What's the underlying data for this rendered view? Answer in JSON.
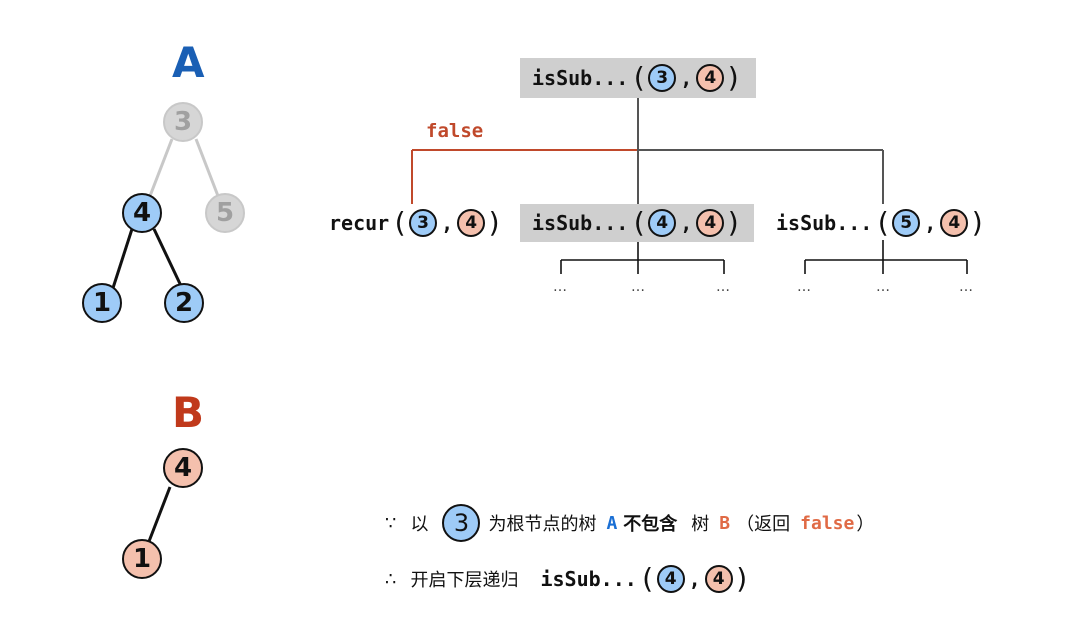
{
  "colors": {
    "blue_fill": "#9ecbf7",
    "pink_fill": "#f4c0ad",
    "gray_fill": "#d6d6d6",
    "label_a": "#1a5fb4",
    "label_b": "#c0391b",
    "false_path": "#c0492b",
    "highlight": "#cfcfcf"
  },
  "tree_a": {
    "label": "A",
    "nodes": [
      {
        "id": "3",
        "value": "3",
        "state": "visited"
      },
      {
        "id": "4",
        "value": "4",
        "state": "active"
      },
      {
        "id": "5",
        "value": "5",
        "state": "visited"
      },
      {
        "id": "1",
        "value": "1",
        "state": "active"
      },
      {
        "id": "2",
        "value": "2",
        "state": "active"
      }
    ]
  },
  "tree_b": {
    "label": "B",
    "nodes": [
      {
        "id": "4",
        "value": "4"
      },
      {
        "id": "1",
        "value": "1"
      }
    ]
  },
  "recursion": {
    "root": {
      "fn": "isSub...",
      "a": "3",
      "b": "4"
    },
    "false_label": "false",
    "children": [
      {
        "fn": "recur",
        "a": "3",
        "b": "4"
      },
      {
        "fn": "isSub...",
        "a": "4",
        "b": "4"
      },
      {
        "fn": "isSub...",
        "a": "5",
        "b": "4"
      }
    ],
    "ellipsis": "…",
    "paren_open": "(",
    "paren_close": ")",
    "comma": ","
  },
  "notes": {
    "line1": {
      "symbol": "∵",
      "prefix": "以",
      "node": "3",
      "mid": "为根节点的树",
      "tree_a": "A",
      "not_contain": "不包含",
      "tree_word": "树",
      "tree_b": "B",
      "paren_open": "（返回",
      "ret": "false",
      "paren_close": "）"
    },
    "line2": {
      "symbol": "∴",
      "text": "开启下层递归",
      "fn": "isSub...",
      "a": "4",
      "b": "4"
    }
  }
}
